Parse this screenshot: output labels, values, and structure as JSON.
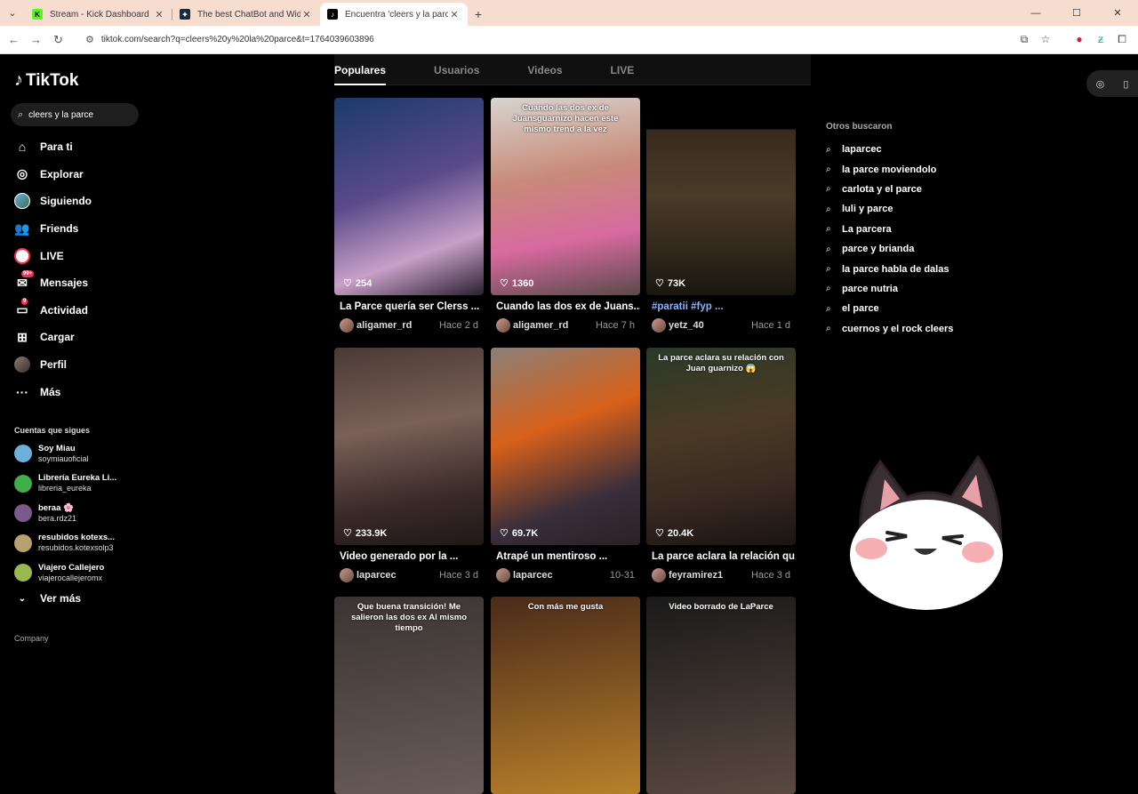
{
  "browser": {
    "tabs": [
      {
        "title": "Stream - Kick Dashboard",
        "fav_color": "#53fc18",
        "fav_char": "K"
      },
      {
        "title": "The best ChatBot and Widgets",
        "fav_color": "#1a2a3a",
        "fav_char": "✦"
      },
      {
        "title": "Encuentra 'cleers y la parce' en",
        "fav_color": "#000000",
        "fav_char": "♪"
      }
    ],
    "url": "tiktok.com/search?q=cleers%20y%20la%20parce&t=1764039603896"
  },
  "tiktok": {
    "logo": "TikTok",
    "search_value": "cleers y la parce",
    "nav": [
      {
        "label": "Para ti",
        "icon": "home-icon",
        "glyph": "⌂"
      },
      {
        "label": "Explorar",
        "icon": "compass-icon",
        "glyph": "◎"
      },
      {
        "label": "Siguiendo",
        "icon": "following-avatar-icon",
        "glyph": ""
      },
      {
        "label": "Friends",
        "icon": "friends-icon",
        "glyph": "👥"
      },
      {
        "label": "LIVE",
        "icon": "live-icon",
        "glyph": ""
      },
      {
        "label": "Mensajes",
        "icon": "messages-icon",
        "glyph": "✉",
        "badge": "99+"
      },
      {
        "label": "Actividad",
        "icon": "activity-icon",
        "glyph": "▭",
        "badge": "9"
      },
      {
        "label": "Cargar",
        "icon": "upload-icon",
        "glyph": "⊞"
      },
      {
        "label": "Perfil",
        "icon": "profile-avatar-icon",
        "glyph": ""
      },
      {
        "label": "Más",
        "icon": "more-icon",
        "glyph": "···"
      }
    ],
    "following_header": "Cuentas que sigues",
    "following": [
      {
        "name": "Soy Miau",
        "handle": "soymiauoficial",
        "color": "#6ab0d8"
      },
      {
        "name": "Librería Eureka Li...",
        "handle": "libreria_eureka",
        "color": "#3fae4a"
      },
      {
        "name": "beraa 🌸",
        "handle": "bera.rdz21",
        "color": "#7a5a8a"
      },
      {
        "name": "resubidos kotexs...",
        "handle": "resubidos.kotexsolp3",
        "color": "#b8a070"
      },
      {
        "name": "Viajero Callejero",
        "handle": "viajerocallejeromx",
        "color": "#9ab850"
      }
    ],
    "ver_mas": "Ver más",
    "company": "Company",
    "tabs": [
      "Populares",
      "Usuarios",
      "Videos",
      "LIVE"
    ],
    "videos": [
      {
        "likes": "254",
        "title": "La Parce quería ser Clerss ...",
        "user": "aligamer_rd",
        "date": "Hace 2 d",
        "caption": "",
        "bg": "linear-gradient(160deg,#1b3a6a 0%,#5a4a8a 45%,#c8a0c8 75%,#2a2030 100%)"
      },
      {
        "likes": "1360",
        "title": "Cuando las dos ex de Juans...",
        "user": "aligamer_rd",
        "date": "Hace 7 h",
        "caption": "Cuando las dos ex de Juansguarnizo hacen este mismo trend a la vez",
        "bg": "linear-gradient(170deg,#d8d4d0 0%,#c88a78 40%,#d86aa0 70%,#5a4a4a 100%)"
      },
      {
        "likes": "73K",
        "title": "#paratii #fyp ...",
        "user": "yetz_40",
        "date": "Hace 1 d",
        "caption": "",
        "bg": "linear-gradient(160deg,#3a2a1e 0%,#4a3a28 40%,#2a2218 70%,#1a1510 100%)"
      },
      {
        "likes": "233.9K",
        "title": "Video generado por la ...",
        "user": "laparcec",
        "date": "Hace 3 d",
        "caption": "",
        "bg": "linear-gradient(170deg,#4a3a34 0%,#7a6058 40%,#3a2a28 75%,#201818 100%)"
      },
      {
        "likes": "69.7K",
        "title": "Atrapé un mentiroso ...",
        "user": "laparcec",
        "date": "10-31",
        "caption": "",
        "bg": "linear-gradient(160deg,#8a8078 0%,#d8601a 40%,#3a2e3a 75%,#2a2024 100%)"
      },
      {
        "likes": "20.4K",
        "title": "La parce aclara la relación qu...",
        "user": "feyramirez1",
        "date": "Hace 3 d",
        "caption": "La parce aclara su relación con Juan guarnizo 😱",
        "bg": "linear-gradient(170deg,#2a3a28 0%,#4a3a24 40%,#3a2a22 70%,#1a1412 100%)"
      },
      {
        "likes": "",
        "title": "",
        "user": "",
        "date": "",
        "caption": "Que buena transición! Me salieron las dos ex Al mismo tiempo",
        "bg": "linear-gradient(170deg,#3a3432 0%,#6a5c58 100%)"
      },
      {
        "likes": "",
        "title": "",
        "user": "",
        "date": "",
        "caption": "Con más me gusta",
        "bg": "linear-gradient(170deg,#4a2a1a 0%,#b8802a 100%)"
      },
      {
        "likes": "",
        "title": "",
        "user": "",
        "date": "",
        "caption": "Video borrado de LaParce",
        "bg": "linear-gradient(170deg,#1a1a1a 0%,#5a4840 100%)"
      }
    ],
    "others_header": "Otros buscaron",
    "others": [
      "laparcec",
      "la parce moviendolo",
      "carlota y el parce",
      "luli y parce",
      "La parcera",
      "parce y brianda",
      "la parce habla de dalas",
      "parce nutria",
      "el parce",
      "cuernos y el rock cleers"
    ]
  }
}
